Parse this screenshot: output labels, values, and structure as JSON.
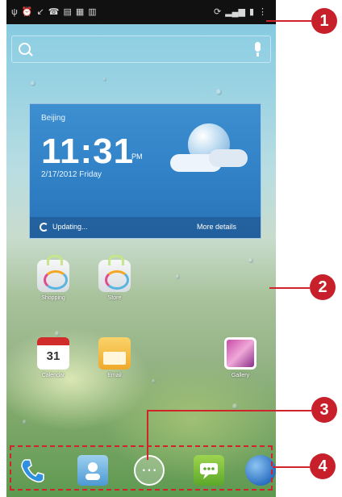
{
  "status_bar": {
    "left_icons": [
      "usb-icon",
      "alarm-icon",
      "missed-call-icon",
      "screenshot-icon",
      "sms-icon",
      "calendar-icon"
    ],
    "right_icons": [
      "sync-icon",
      "signal-icon",
      "battery-icon"
    ]
  },
  "search_bar": {
    "search_icon": "search-icon",
    "voice_icon": "mic-icon"
  },
  "weather_widget": {
    "city": "Beijing",
    "time": "11:31",
    "ampm": "PM",
    "date": "2/17/2012 Friday",
    "status": "Updating...",
    "more": "More details"
  },
  "home_apps": [
    {
      "name": "store-a",
      "label": "Shopping"
    },
    {
      "name": "store-b",
      "label": "Store"
    },
    {
      "name": "calendar",
      "label": "Calendar",
      "day": "31"
    },
    {
      "name": "email",
      "label": "Email"
    },
    {
      "name": "gallery",
      "label": "Gallery"
    }
  ],
  "dock": [
    "phone-icon",
    "contacts-icon",
    "app-launcher-icon",
    "messaging-icon",
    "browser-icon"
  ],
  "callouts": [
    {
      "label": "1"
    },
    {
      "label": "2"
    },
    {
      "label": "3"
    },
    {
      "label": "4"
    }
  ],
  "colors": {
    "accent": "#c8202a",
    "widget": "#2f7fc5",
    "status_bar": "#111111"
  }
}
